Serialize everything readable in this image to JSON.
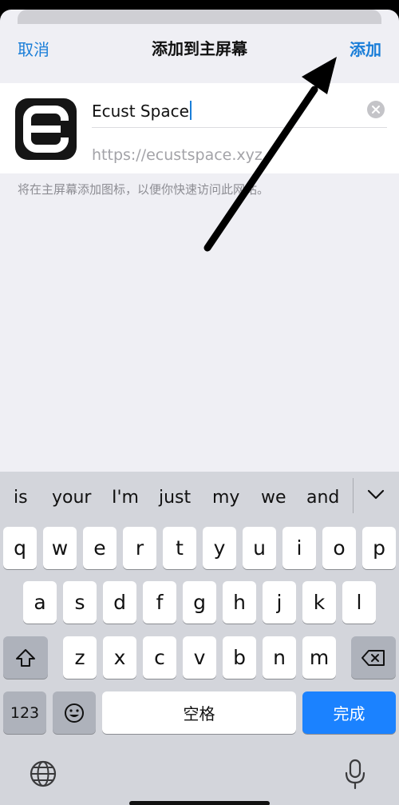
{
  "nav": {
    "cancel_label": "取消",
    "title": "添加到主屏幕",
    "add_label": "添加"
  },
  "bookmark": {
    "name_value": "Ecust Space",
    "url": "https://ecustspace.xyz",
    "icon_letter": "E",
    "hint": "将在主屏幕添加图标，以便你快速访问此网站。"
  },
  "suggestions": [
    "is",
    "your",
    "I'm",
    "just",
    "my",
    "we",
    "and"
  ],
  "keyboard": {
    "row1": [
      "q",
      "w",
      "e",
      "r",
      "t",
      "y",
      "u",
      "i",
      "o",
      "p"
    ],
    "row2": [
      "a",
      "s",
      "d",
      "f",
      "g",
      "h",
      "j",
      "k",
      "l"
    ],
    "row3": [
      "z",
      "x",
      "c",
      "v",
      "b",
      "n",
      "m"
    ],
    "numbers_label": "123",
    "space_label": "空格",
    "done_label": "完成"
  },
  "colors": {
    "accent": "#1a7ed8",
    "done_key": "#1b82ff",
    "sheet_bg": "#efeff4",
    "keyboard_bg": "#d3d5db"
  }
}
